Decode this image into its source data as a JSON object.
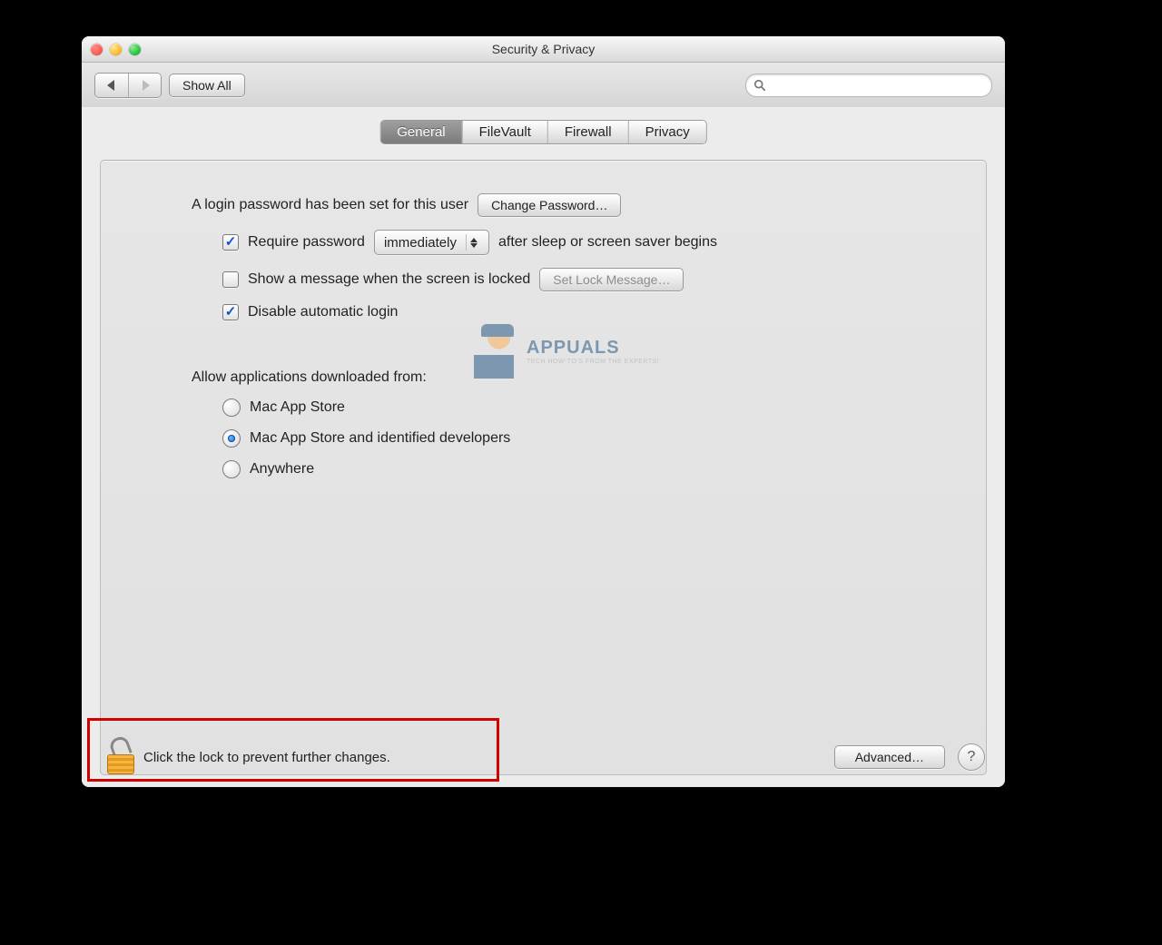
{
  "window": {
    "title": "Security & Privacy"
  },
  "toolbar": {
    "show_all_label": "Show All",
    "search_placeholder": ""
  },
  "tabs": [
    {
      "label": "General",
      "active": true
    },
    {
      "label": "FileVault",
      "active": false
    },
    {
      "label": "Firewall",
      "active": false
    },
    {
      "label": "Privacy",
      "active": false
    }
  ],
  "general": {
    "login_password_text": "A login password has been set for this user",
    "change_password_label": "Change Password…",
    "require_password": {
      "checked": true,
      "prefix_label": "Require password",
      "delay_value": "immediately",
      "suffix_label": "after sleep or screen saver begins"
    },
    "show_lock_message": {
      "checked": false,
      "label": "Show a message when the screen is locked",
      "button_label": "Set Lock Message…",
      "button_enabled": false
    },
    "disable_auto_login": {
      "checked": true,
      "label": "Disable automatic login"
    },
    "gatekeeper": {
      "heading": "Allow applications downloaded from:",
      "options": [
        {
          "label": "Mac App Store",
          "selected": false
        },
        {
          "label": "Mac App Store and identified developers",
          "selected": true
        },
        {
          "label": "Anywhere",
          "selected": false
        }
      ]
    }
  },
  "footer": {
    "lock_text": "Click the lock to prevent further changes.",
    "advanced_label": "Advanced…",
    "help_label": "?"
  },
  "watermark": {
    "brand": "APPUALS",
    "tagline": "TECH HOW-TO'S FROM THE EXPERTS!"
  }
}
